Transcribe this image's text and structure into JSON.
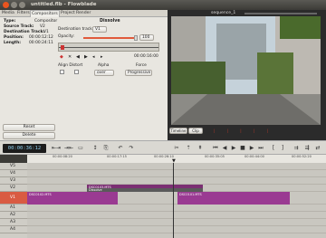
{
  "window": {
    "title": "untitled.flb - Flowblade"
  },
  "tabs": [
    "Media",
    "Filters",
    "Compositors",
    "Project",
    "Render"
  ],
  "compositor": {
    "info": [
      {
        "key": "Type:",
        "value": "Compositor"
      },
      {
        "key": "Source Track:",
        "value": "V2"
      },
      {
        "key": "Destination Track:",
        "value": "V1"
      },
      {
        "key": "Position:",
        "value": "00:00:12:12"
      },
      {
        "key": "Length:",
        "value": "00:00:24:11"
      }
    ],
    "title": "Dissolve",
    "dest_track_label": "Destination track:",
    "dest_track_value": "V1",
    "opacity_label": "Opacity:",
    "opacity_value": "100",
    "keyframe_time": "00:00:16:00",
    "align_label": "Align Distort",
    "alpha_label": "Alpha",
    "alpha_value": "over",
    "force_label": "Force",
    "force_value": "Progressive",
    "reset_label": "Reset",
    "delete_label": "Delete"
  },
  "monitor": {
    "sequence_label": "sequence_1",
    "timeline_btn": "Timeline",
    "clip_btn": "Clip"
  },
  "toolbar": {
    "timecode": "00:00:36:12"
  },
  "ruler": {
    "ticks": [
      "00:00:08:20",
      "00:00:17:15",
      "00:00:26:10",
      "00:00:35:05",
      "00:00:44:00",
      "00:00:52:20"
    ]
  },
  "tracks": [
    "V5",
    "V4",
    "V3",
    "V2",
    "V1",
    "A1",
    "A2",
    "A3",
    "A4"
  ],
  "clips": {
    "v2_clip": "DSC0103.MTS",
    "v2_compositor": "Dissolve",
    "v1_clip_a": "DSC0102.MTS",
    "v1_clip_b": "DSC0101.MTS"
  }
}
